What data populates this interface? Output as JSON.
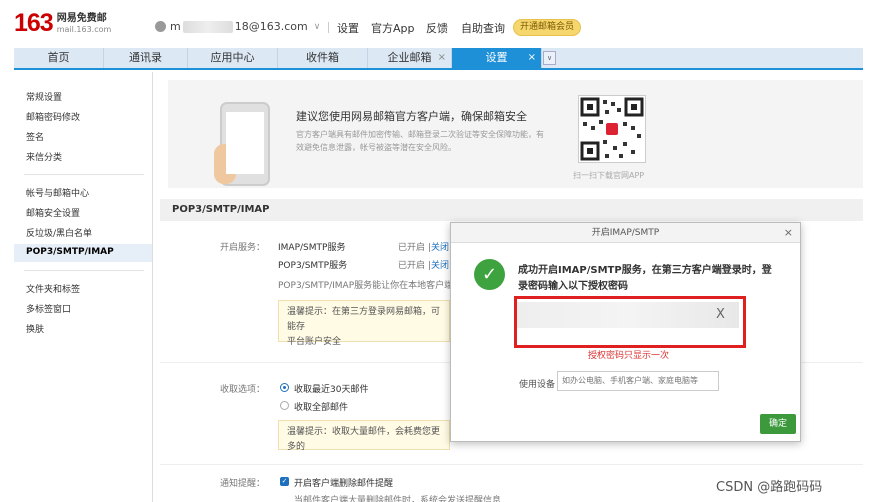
{
  "header": {
    "logo_num": "163",
    "logo_line1": "网易免费邮",
    "logo_line2": "mail.163.com",
    "account_prefix": "m",
    "account_suffix": "18@163.com",
    "links": [
      "设置",
      "官方App",
      "反馈",
      "自助查询"
    ],
    "vip_label": "开通邮箱会员"
  },
  "tabs": [
    {
      "label": "首页"
    },
    {
      "label": "通讯录"
    },
    {
      "label": "应用中心"
    },
    {
      "label": "收件箱"
    },
    {
      "label": "企业邮箱",
      "close": "×"
    },
    {
      "label": "设置",
      "close": "×"
    }
  ],
  "tab_more": "∨",
  "sidebar": {
    "groups": [
      [
        "常规设置",
        "邮箱密码修改",
        "签名",
        "来信分类"
      ],
      [
        "帐号与邮箱中心",
        "邮箱安全设置",
        "反垃圾/黑白名单",
        "POP3/SMTP/IMAP"
      ],
      [
        "文件夹和标签",
        "多标签窗口",
        "换肤"
      ]
    ]
  },
  "promo": {
    "title": "建议您使用网易邮箱官方客户端，确保邮箱安全",
    "desc": "官方客户端具有邮件加密传输、邮箱登录二次验证等安全保障功能，有效避免信息泄露，帐号被盗等潜在安全风险。",
    "qr_caption": "扫一扫下载官网APP"
  },
  "section": {
    "title": "POP3/SMTP/IMAP",
    "enable_label": "开启服务：",
    "services": [
      {
        "name": "IMAP/SMTP服务",
        "status": "已开启 |",
        "action": "关闭"
      },
      {
        "name": "POP3/SMTP服务",
        "status": "已开启 |",
        "action": "关闭"
      }
    ],
    "pop_note": "POP3/SMTP/IMAP服务能让你在本地客户端",
    "tip1_a": "温馨提示：在第三方登录网易邮箱，可能存",
    "tip1_b": "平台账户安全",
    "receive_label": "收取选项：",
    "receive_options": [
      "收取最近30天邮件",
      "收取全部邮件"
    ],
    "tip2": "温馨提示：收取大量邮件，会耗费您更多的",
    "notify_label": "通知提醒：",
    "notify_option": "开启客户端删除邮件提醒",
    "notify_sub": "当邮件客户端大量删除邮件时，系统会发送提醒信息"
  },
  "modal": {
    "title": "开启IMAP/SMTP",
    "close": "×",
    "check": "✓",
    "message": "成功开启IMAP/SMTP服务，在第三方客户端登录时，登录密码输入以下授权密码",
    "code_end": "X",
    "once_note": "授权密码只显示一次",
    "device_label": "使用设备",
    "device_placeholder": "如办公电脑、手机客户端、家庭电脑等",
    "ok_label": "确定"
  },
  "watermark": "CSDN @路跑码码"
}
